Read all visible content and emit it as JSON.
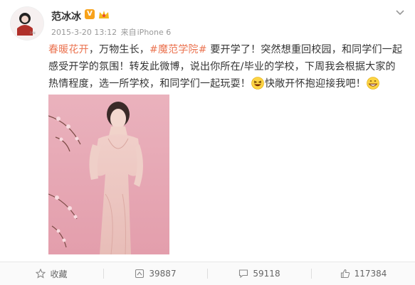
{
  "post": {
    "author": "范冰冰",
    "verified_badge": "V",
    "timestamp": "2015-3-20 13:12",
    "source_prefix": "来自",
    "source": "iPhone 6",
    "text": {
      "hashtag1": "春暖花开",
      "seg1": "，万物生长，",
      "hashtag2": "#魔范学院#",
      "seg2": "要开学了！突然想重回校园，和同学们一起感受开学的氛围！转发此微博，说出你所在/毕业的学校，下周我会根据大家的热情程度，选一所学校，和同学们一起玩耍！",
      "seg3": "快敞开怀抱迎接我吧！"
    }
  },
  "toolbar": {
    "favorite_label": "收藏",
    "repost_count": "39887",
    "comment_count": "59118",
    "like_count": "117384"
  },
  "colors": {
    "highlight": "#eb7350",
    "vip": "#f8a21a",
    "photo_background": "#e7a6b2"
  }
}
